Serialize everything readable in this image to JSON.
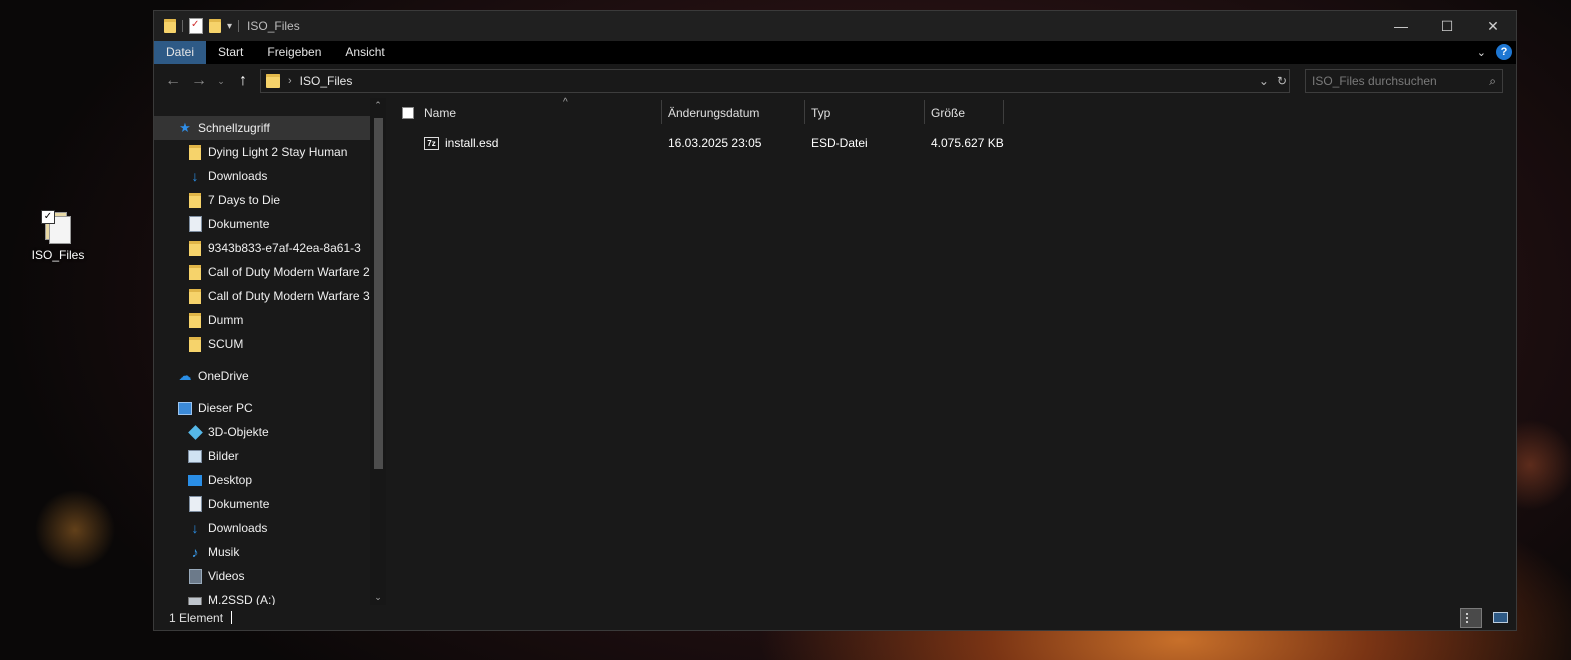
{
  "desktop": {
    "icon_label": "ISO_Files"
  },
  "window": {
    "title": "ISO_Files",
    "controls": {
      "minimize": "—",
      "maximize": "☐",
      "close": "✕"
    },
    "qa_dropdown": "▾"
  },
  "ribbon": {
    "tabs": [
      "Datei",
      "Start",
      "Freigeben",
      "Ansicht"
    ],
    "help": "?",
    "expand": "⌄"
  },
  "navbar": {
    "back": "←",
    "forward": "→",
    "recent": "⌄",
    "up": "↑",
    "breadcrumb": "ISO_Files",
    "crumb_sep": "›",
    "addr_dropdown": "⌄",
    "refresh": "↻",
    "search_placeholder": "ISO_Files durchsuchen",
    "search_icon": "⌕"
  },
  "nav_pane": {
    "quick_access": "Schnellzugriff",
    "quick_items": [
      {
        "label": "Dying Light 2 Stay Human",
        "icon": "folder-icon",
        "pinned": true
      },
      {
        "label": "Downloads",
        "icon": "download-icon",
        "pinned": true
      },
      {
        "label": "7 Days to Die",
        "icon": "folder-icon",
        "pinned": true
      },
      {
        "label": "Dokumente",
        "icon": "documents-icon",
        "pinned": true
      },
      {
        "label": "9343b833-e7af-42ea-8a61-3",
        "icon": "folder-icon",
        "pinned": true
      },
      {
        "label": "Call of Duty  Modern Warfare 2",
        "icon": "folder-icon",
        "pinned": false
      },
      {
        "label": "Call of Duty  Modern Warfare 3",
        "icon": "folder-icon",
        "pinned": false
      },
      {
        "label": "Dumm",
        "icon": "folder-icon",
        "pinned": false
      },
      {
        "label": "SCUM",
        "icon": "folder-icon",
        "pinned": false
      }
    ],
    "pin_glyph": "📌",
    "onedrive": "OneDrive",
    "this_pc": "Dieser PC",
    "pc_items": [
      {
        "label": "3D-Objekte",
        "icon": "3d-objects-icon"
      },
      {
        "label": "Bilder",
        "icon": "pictures-icon"
      },
      {
        "label": "Desktop",
        "icon": "desktop-icon"
      },
      {
        "label": "Dokumente",
        "icon": "documents-icon"
      },
      {
        "label": "Downloads",
        "icon": "download-icon"
      },
      {
        "label": "Musik",
        "icon": "music-icon"
      },
      {
        "label": "Videos",
        "icon": "videos-icon"
      },
      {
        "label": "M.2SSD (A:)",
        "icon": "drive-icon"
      }
    ],
    "scroll_up": "⌃",
    "scroll_down": "⌄"
  },
  "file_list": {
    "columns": [
      "Name",
      "Änderungsdatum",
      "Typ",
      "Größe"
    ],
    "sort_indicator": "^",
    "rows": [
      {
        "name": "install.esd",
        "modified": "16.03.2025 23:05",
        "type": "ESD-Datei",
        "size": "4.075.627 KB",
        "icon_text": "7z"
      }
    ]
  },
  "status": {
    "count": "1 Element"
  }
}
